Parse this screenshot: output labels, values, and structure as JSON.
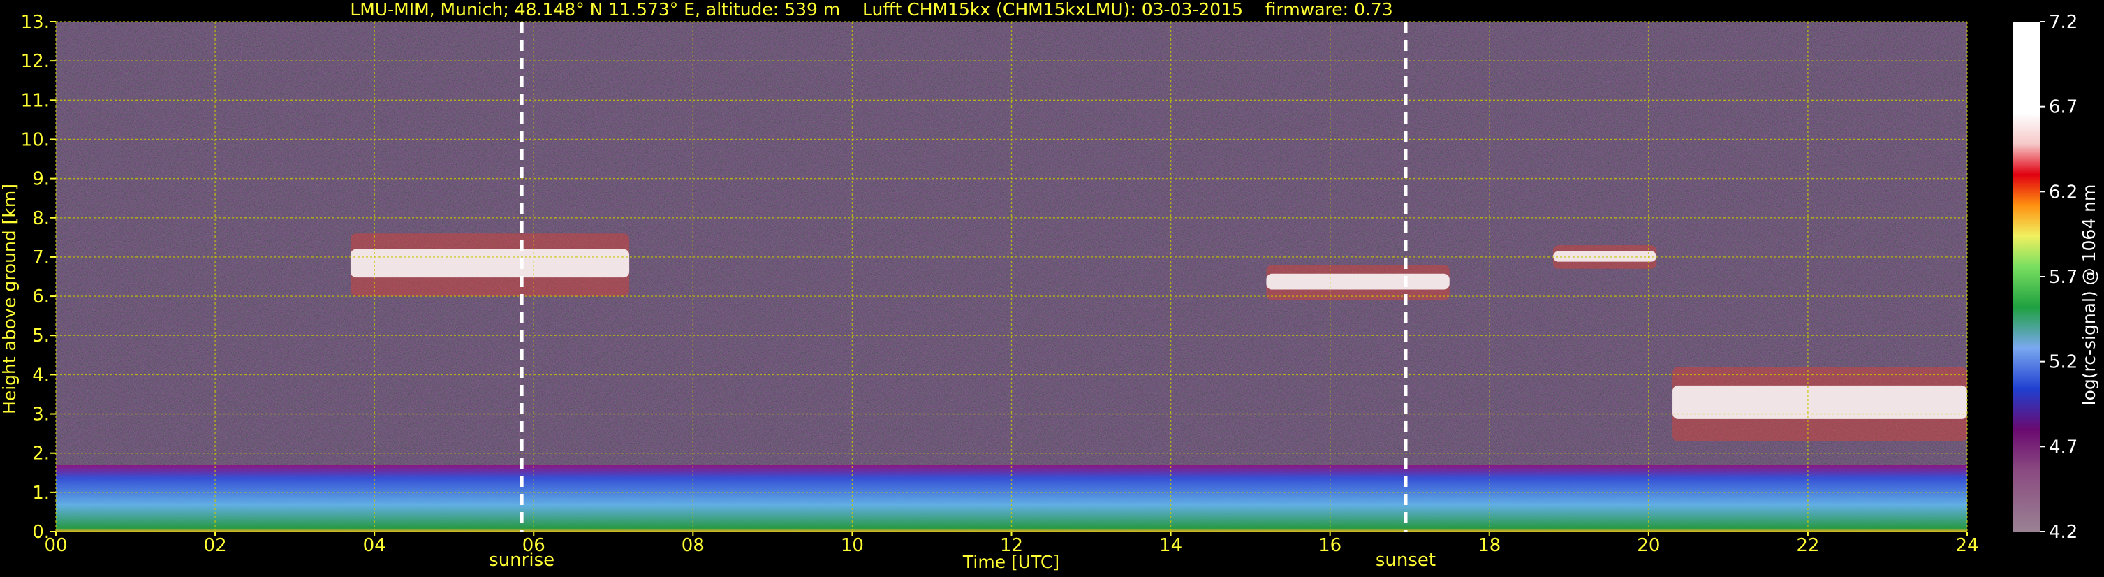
{
  "chart_data": {
    "type": "heatmap",
    "title": "LMU-MIM, Munich; 48.148° N 11.573° E, altitude: 539 m    Lufft CHM15kx (CHM15kxLMU): 03-03-2015    firmware: 0.73",
    "xlabel": "Time [UTC]",
    "ylabel": "Height above ground [km]",
    "xlim": [
      0,
      24
    ],
    "ylim": [
      0,
      13
    ],
    "x_ticks": [
      "00",
      "02",
      "04",
      "06",
      "08",
      "10",
      "12",
      "14",
      "16",
      "18",
      "20",
      "22",
      "24"
    ],
    "y_ticks": [
      "0.",
      "1.",
      "2.",
      "3.",
      "4.",
      "5.",
      "6.",
      "7.",
      "8.",
      "9.",
      "10.",
      "11.",
      "12.",
      "13."
    ],
    "grid": true,
    "markers": [
      {
        "label": "sunrise",
        "time": 5.85
      },
      {
        "label": "sunset",
        "time": 16.95
      }
    ],
    "colorbar": {
      "label": "log(rc-signal) @ 1064 nm",
      "range": [
        4.2,
        7.2
      ],
      "ticks": [
        "4.2",
        "4.7",
        "5.2",
        "5.7",
        "6.2",
        "6.7",
        "7.2"
      ]
    },
    "features": [
      {
        "name": "boundary layer aerosol",
        "t_start": 0,
        "t_end": 24,
        "top_km": 1.7
      },
      {
        "name": "cloud layer",
        "t_start": 3.7,
        "t_end": 7.2,
        "base_km": 6.0,
        "top_km": 7.6
      },
      {
        "name": "cloud layer",
        "t_start": 15.2,
        "t_end": 17.5,
        "base_km": 5.9,
        "top_km": 6.8
      },
      {
        "name": "cloud layer",
        "t_start": 18.8,
        "t_end": 20.1,
        "base_km": 6.7,
        "top_km": 7.3
      },
      {
        "name": "low cloud",
        "t_start": 20.3,
        "t_end": 24,
        "base_km": 2.3,
        "top_km": 4.2
      }
    ]
  },
  "colors": {
    "text": "#ffff33",
    "grid": "#c8c800",
    "background": "#000000"
  }
}
